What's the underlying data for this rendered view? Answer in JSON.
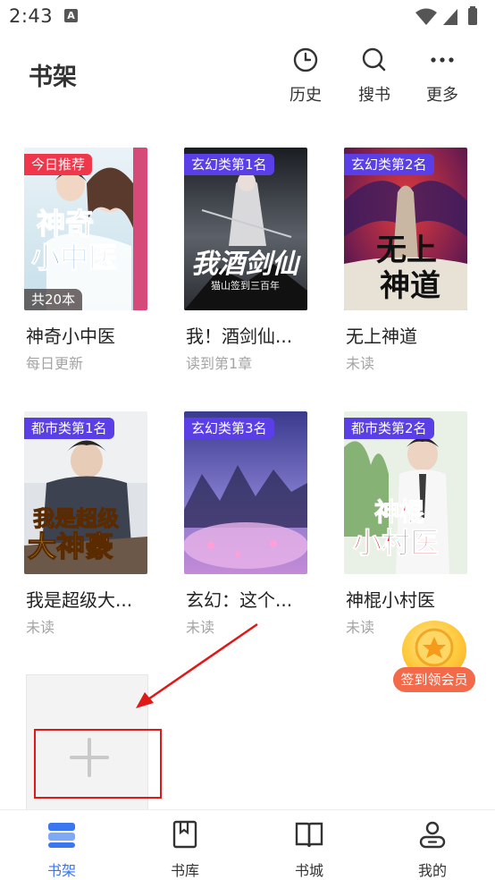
{
  "status_bar": {
    "time": "2:43",
    "notification_letter": "A",
    "icons": [
      "wifi-icon",
      "signal-icon",
      "battery-icon"
    ]
  },
  "header": {
    "title": "书架",
    "actions": [
      {
        "label": "历史",
        "icon": "clock-icon"
      },
      {
        "label": "搜书",
        "icon": "search-icon"
      },
      {
        "label": "更多",
        "icon": "more-dots-icon"
      }
    ]
  },
  "books": [
    {
      "title": "神奇小中医",
      "status": "每日更新",
      "badge": "今日推荐",
      "badge_color": "#f0364a",
      "count_label": "共20本",
      "cover_text": "神奇小中医"
    },
    {
      "title": "我！酒剑仙...",
      "status": "读到第1章",
      "badge": "玄幻类第1名",
      "badge_color": "#5a3ee6",
      "cover_text": "我酒剑仙",
      "cover_subtext": "猫山签到三百年"
    },
    {
      "title": "无上神道",
      "status": "未读",
      "badge": "玄幻类第2名",
      "badge_color": "#5a3ee6",
      "cover_text": "无上神道"
    },
    {
      "title": "我是超级大...",
      "status": "未读",
      "badge": "都市类第1名",
      "badge_color": "#5a3ee6",
      "cover_text": "我是超级大神豪"
    },
    {
      "title": "玄幻：这个...",
      "status": "未读",
      "badge": "玄幻类第3名",
      "badge_color": "#5a3ee6"
    },
    {
      "title": "神棍小村医",
      "status": "未读",
      "badge": "都市类第2名",
      "badge_color": "#5a3ee6",
      "cover_text": "神棍小村医"
    }
  ],
  "add_book": {
    "icon": "plus-icon"
  },
  "signin": {
    "label": "签到领会员",
    "icon": "star-icon"
  },
  "bottom_nav": [
    {
      "label": "书架",
      "icon": "bookshelf-icon",
      "active": true
    },
    {
      "label": "书库",
      "icon": "book-icon",
      "active": false
    },
    {
      "label": "书城",
      "icon": "open-book-icon",
      "active": false
    },
    {
      "label": "我的",
      "icon": "profile-icon",
      "active": false
    }
  ],
  "colors": {
    "accent": "#3a76f0",
    "badge_red": "#f0364a",
    "badge_purple": "#5a3ee6",
    "annotation_red": "#e01818"
  }
}
